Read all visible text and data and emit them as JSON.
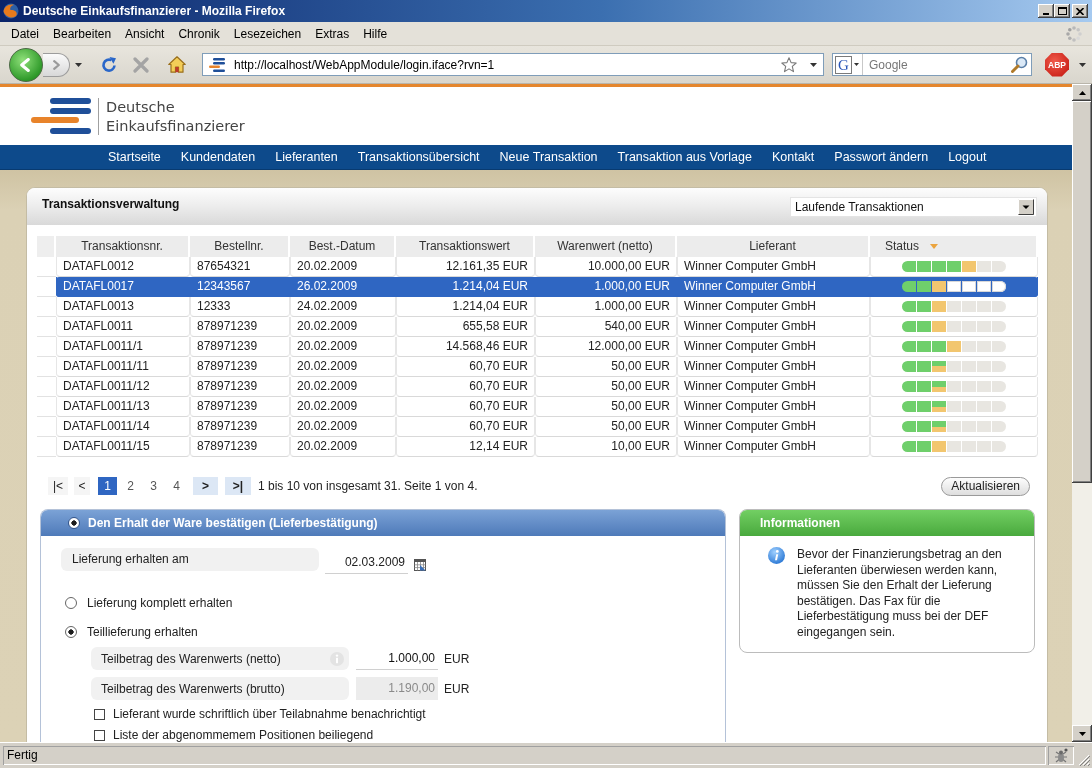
{
  "window": {
    "title": "Deutsche Einkaufsfinanzierer - Mozilla Firefox"
  },
  "menu_bar": [
    "Datei",
    "Bearbeiten",
    "Ansicht",
    "Chronik",
    "Lesezeichen",
    "Extras",
    "Hilfe"
  ],
  "toolbar": {
    "url": "http://localhost/WebAppModule/login.iface?rvn=1",
    "search_engine": "G",
    "search_placeholder": "Google",
    "adblock": "ABP"
  },
  "site_header": {
    "brand_lines": [
      "Deutsche",
      "Einkaufsfinanzierer"
    ]
  },
  "main_nav": [
    "Startseite",
    "Kundendaten",
    "Lieferanten",
    "Transaktionsübersicht",
    "Neue Transaktion",
    "Transaktion aus Vorlage",
    "Kontakt",
    "Passwort ändern",
    "Logout"
  ],
  "transactions": {
    "title": "Transaktionsverwaltung",
    "filter": "Laufende Transaktionen",
    "table": {
      "columns": [
        {
          "label": "Transaktionsnr.",
          "kind": "text",
          "sorted": false
        },
        {
          "label": "Bestellnr.",
          "kind": "text",
          "sorted": false
        },
        {
          "label": "Best.-Datum",
          "kind": "text",
          "sorted": false
        },
        {
          "label": "Transaktionswert",
          "kind": "amount",
          "sorted": false
        },
        {
          "label": "Warenwert (netto)",
          "kind": "amount",
          "sorted": false
        },
        {
          "label": "Lieferant",
          "kind": "text",
          "sorted": false
        },
        {
          "label": "Status",
          "kind": "status",
          "sorted": true
        }
      ],
      "rows": [
        {
          "selected": false,
          "cells": [
            "DATAFL0012",
            "87654321",
            "20.02.2009",
            "12.161,35 EUR",
            "10.000,00 EUR",
            "Winner Computer GmbH"
          ],
          "status": [
            {
              "kind": "done"
            },
            {
              "kind": "done"
            },
            {
              "kind": "done"
            },
            {
              "kind": "done"
            },
            {
              "kind": "current"
            },
            {
              "kind": "open"
            },
            {
              "kind": "open"
            }
          ]
        },
        {
          "selected": true,
          "cells": [
            "DATAFL0017",
            "12343567",
            "26.02.2009",
            "1.214,04 EUR",
            "1.000,00 EUR",
            "Winner Computer GmbH"
          ],
          "status": [
            {
              "kind": "done"
            },
            {
              "kind": "done"
            },
            {
              "kind": "current"
            },
            {
              "kind": "open"
            },
            {
              "kind": "open"
            },
            {
              "kind": "open"
            },
            {
              "kind": "open"
            }
          ]
        },
        {
          "selected": false,
          "cells": [
            "DATAFL0013",
            "12333",
            "24.02.2009",
            "1.214,04 EUR",
            "1.000,00 EUR",
            "Winner Computer GmbH"
          ],
          "status": [
            {
              "kind": "done"
            },
            {
              "kind": "done"
            },
            {
              "kind": "current"
            },
            {
              "kind": "open"
            },
            {
              "kind": "open"
            },
            {
              "kind": "open"
            },
            {
              "kind": "open"
            }
          ]
        },
        {
          "selected": false,
          "cells": [
            "DATAFL0011",
            "878971239",
            "20.02.2009",
            "655,58 EUR",
            "540,00 EUR",
            "Winner Computer GmbH"
          ],
          "status": [
            {
              "kind": "done"
            },
            {
              "kind": "done"
            },
            {
              "kind": "current"
            },
            {
              "kind": "open"
            },
            {
              "kind": "open"
            },
            {
              "kind": "open"
            },
            {
              "kind": "open"
            }
          ]
        },
        {
          "selected": false,
          "cells": [
            "DATAFL0011/1",
            "878971239",
            "20.02.2009",
            "14.568,46 EUR",
            "12.000,00 EUR",
            "Winner Computer GmbH"
          ],
          "status": [
            {
              "kind": "done"
            },
            {
              "kind": "done"
            },
            {
              "kind": "done"
            },
            {
              "kind": "current"
            },
            {
              "kind": "open"
            },
            {
              "kind": "open"
            },
            {
              "kind": "open"
            }
          ]
        },
        {
          "selected": false,
          "cells": [
            "DATAFL0011/11",
            "878971239",
            "20.02.2009",
            "60,70 EUR",
            "50,00 EUR",
            "Winner Computer GmbH"
          ],
          "status": [
            {
              "kind": "done"
            },
            {
              "kind": "done"
            },
            {
              "kind": "partial"
            },
            {
              "kind": "open"
            },
            {
              "kind": "open"
            },
            {
              "kind": "open"
            },
            {
              "kind": "open"
            }
          ]
        },
        {
          "selected": false,
          "cells": [
            "DATAFL0011/12",
            "878971239",
            "20.02.2009",
            "60,70 EUR",
            "50,00 EUR",
            "Winner Computer GmbH"
          ],
          "status": [
            {
              "kind": "done"
            },
            {
              "kind": "done"
            },
            {
              "kind": "partial"
            },
            {
              "kind": "open"
            },
            {
              "kind": "open"
            },
            {
              "kind": "open"
            },
            {
              "kind": "open"
            }
          ]
        },
        {
          "selected": false,
          "cells": [
            "DATAFL0011/13",
            "878971239",
            "20.02.2009",
            "60,70 EUR",
            "50,00 EUR",
            "Winner Computer GmbH"
          ],
          "status": [
            {
              "kind": "done"
            },
            {
              "kind": "done"
            },
            {
              "kind": "partial"
            },
            {
              "kind": "open"
            },
            {
              "kind": "open"
            },
            {
              "kind": "open"
            },
            {
              "kind": "open"
            }
          ]
        },
        {
          "selected": false,
          "cells": [
            "DATAFL0011/14",
            "878971239",
            "20.02.2009",
            "60,70 EUR",
            "50,00 EUR",
            "Winner Computer GmbH"
          ],
          "status": [
            {
              "kind": "done"
            },
            {
              "kind": "done"
            },
            {
              "kind": "partial"
            },
            {
              "kind": "open"
            },
            {
              "kind": "open"
            },
            {
              "kind": "open"
            },
            {
              "kind": "open"
            }
          ]
        },
        {
          "selected": false,
          "cells": [
            "DATAFL0011/15",
            "878971239",
            "20.02.2009",
            "12,14 EUR",
            "10,00 EUR",
            "Winner Computer GmbH"
          ],
          "status": [
            {
              "kind": "done"
            },
            {
              "kind": "done"
            },
            {
              "kind": "current"
            },
            {
              "kind": "open"
            },
            {
              "kind": "open"
            },
            {
              "kind": "open"
            },
            {
              "kind": "open"
            }
          ]
        }
      ]
    },
    "pagination": {
      "first": {
        "label": "|<",
        "disabled": true
      },
      "previous": {
        "label": "<",
        "disabled": true
      },
      "pages": [
        {
          "label": "1",
          "selected": true
        },
        {
          "label": "2",
          "selected": false
        },
        {
          "label": "3",
          "selected": false
        },
        {
          "label": "4",
          "selected": false
        }
      ],
      "next": {
        "label": ">",
        "disabled": false
      },
      "last": {
        "label": ">|",
        "disabled": false
      },
      "summary": "1 bis 10 von insgesamt 31. Seite 1 von 4."
    },
    "refresh_button": "Aktualisieren"
  },
  "delivery": {
    "title": "Den Erhalt der Ware bestätigen (Lieferbestätigung)",
    "selected": true,
    "date": {
      "label": "Lieferung erhalten am",
      "value": "02.03.2009"
    },
    "options": [
      {
        "label": "Lieferung komplett erhalten",
        "selected": false
      },
      {
        "label": "Teillieferung erhalten",
        "selected": true
      }
    ],
    "amounts": [
      {
        "label": "Teilbetrag des Warenwerts (netto)",
        "value": "1.000,00",
        "unit": "EUR",
        "info": true,
        "disabled": false
      },
      {
        "label": "Teilbetrag des Warenwerts (brutto)",
        "value": "1.190,00",
        "unit": "EUR",
        "info": false,
        "disabled": true
      }
    ],
    "checkboxes": [
      {
        "label": "Lieferant wurde schriftlich über Teilabnahme benachrichtigt",
        "checked": false
      },
      {
        "label": "Liste der abgenommemem Positionen beiliegend",
        "checked": false
      }
    ]
  },
  "info": {
    "title": "Informationen",
    "text": "Bevor der Finanzierungsbetrag an den Lieferanten überwiesen werden kann, müssen Sie den Erhalt der Lieferung bestätigen. Das Fax für die Lieferbestätigung muss bei der DEF eingegangen sein."
  },
  "status_bar": {
    "text": "Fertig"
  }
}
